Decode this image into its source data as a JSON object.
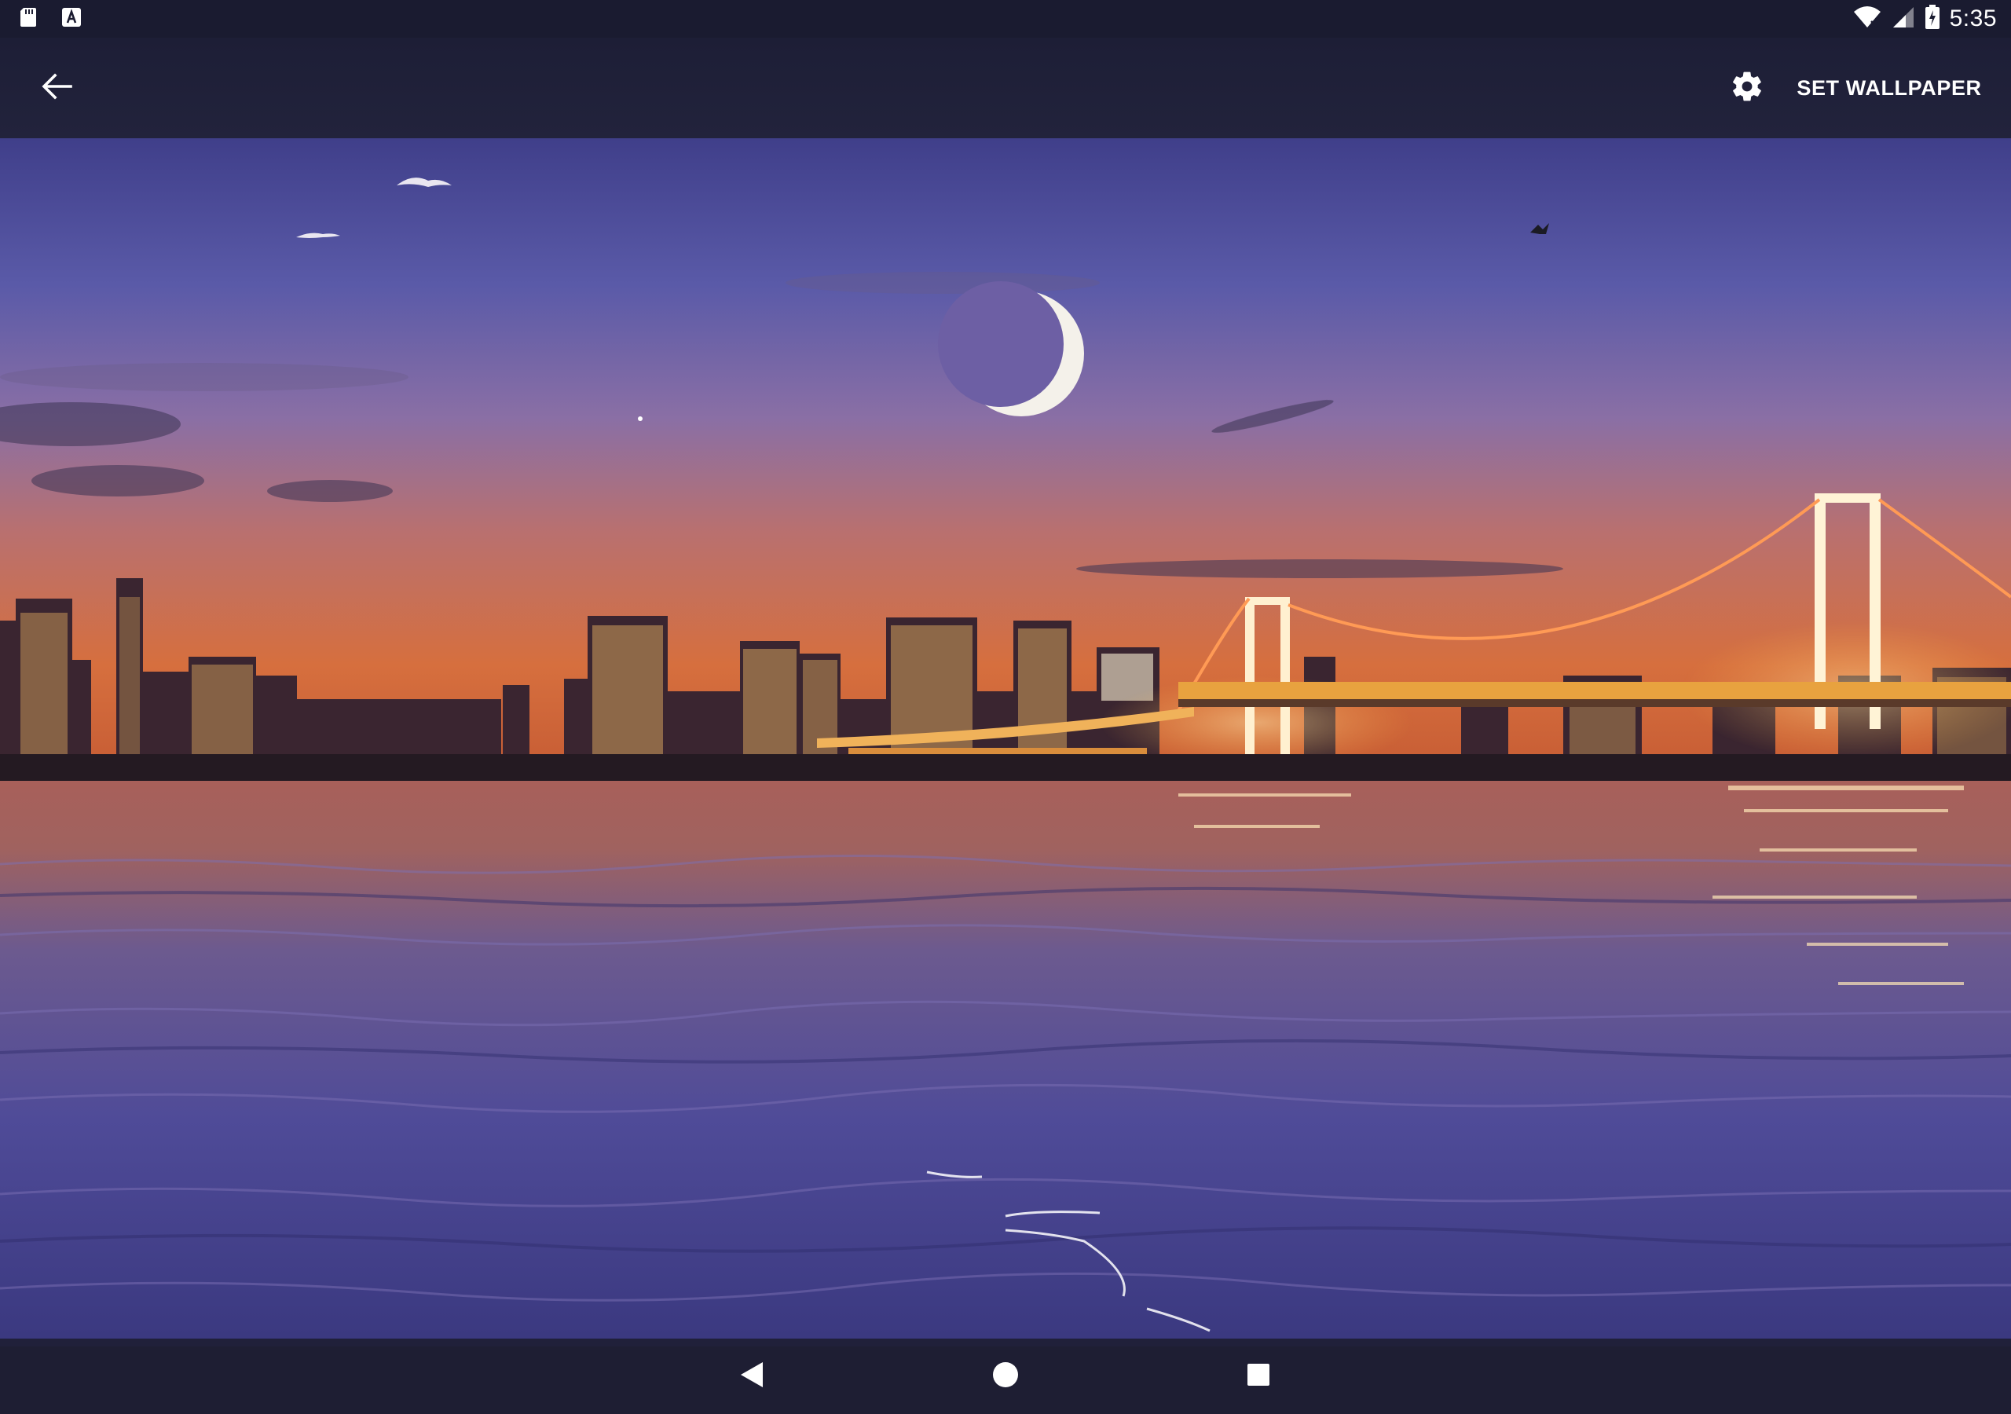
{
  "status_bar": {
    "time": "5:35",
    "left_icons": [
      "sd-card-icon",
      "app-notification-icon"
    ],
    "right_icons": [
      "wifi-icon",
      "cell-signal-icon",
      "battery-charging-icon"
    ]
  },
  "toolbar": {
    "back_icon": "arrow-left-icon",
    "settings_icon": "gear-icon",
    "set_wallpaper_label": "SET WALLPAPER"
  },
  "preview": {
    "elements": [
      "crescent-moon",
      "city-skyline",
      "suspension-bridge",
      "water",
      "birds"
    ]
  },
  "nav_bar": {
    "icons": [
      "nav-back-icon",
      "nav-home-icon",
      "nav-recents-icon"
    ]
  },
  "colors": {
    "bar_background": "#1a1b30",
    "text": "#ffffff",
    "sky_top": "#3f3e8c",
    "sky_horizon": "#d8703f",
    "water": "#4f4b95",
    "city_lights": "#ffb347"
  }
}
